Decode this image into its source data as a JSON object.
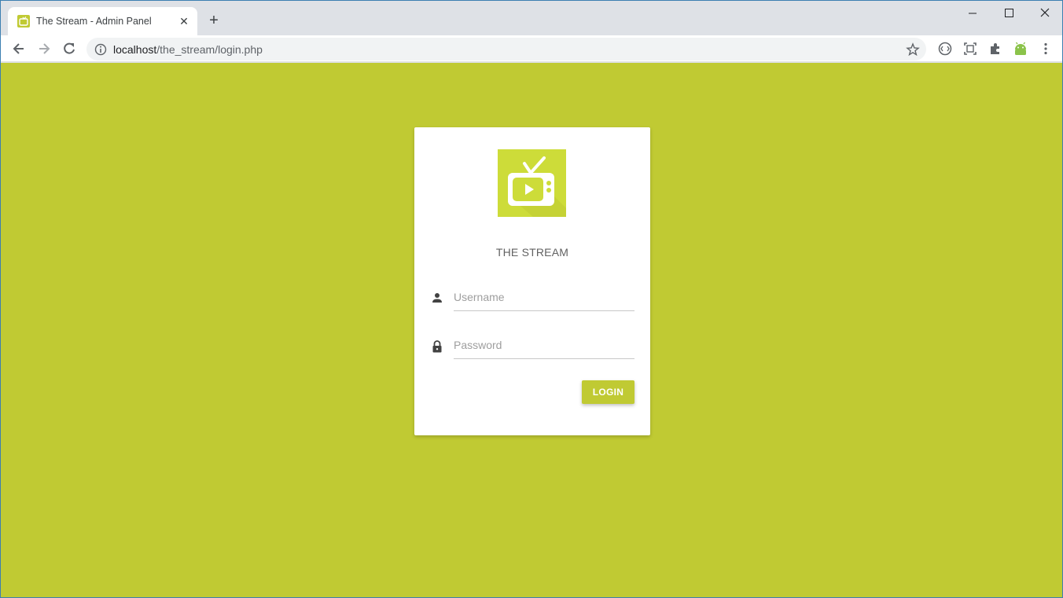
{
  "browser": {
    "tab_title": "The Stream - Admin Panel",
    "tab_close_glyph": "✕",
    "new_tab_glyph": "+",
    "url_host": "localhost",
    "url_path": "/the_stream/login.php",
    "icons": [
      "back-icon",
      "forward-icon",
      "reload-icon",
      "info-icon",
      "star-icon",
      "extension-icons",
      "menu-icon"
    ]
  },
  "login": {
    "brand": "THE STREAM",
    "username_placeholder": "Username",
    "password_placeholder": "Password",
    "login_label": "LOGIN",
    "accent_color": "#c0ca33",
    "logo_color": "#cddc39"
  }
}
